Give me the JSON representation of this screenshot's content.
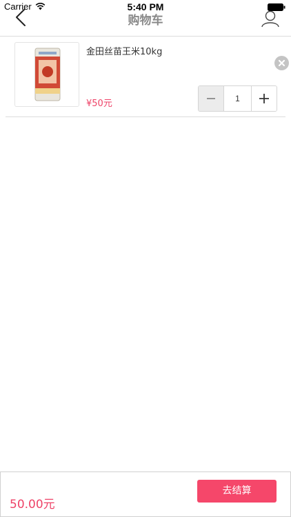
{
  "status_bar": {
    "carrier": "Carrier",
    "time": "5:40 PM"
  },
  "nav": {
    "title": "购物车",
    "back_icon": "chevron-left-icon",
    "user_icon": "user-icon"
  },
  "cart": {
    "items": [
      {
        "name": "金田丝苗王米10kg",
        "price": "¥50元",
        "quantity": "1",
        "minus_label": "−",
        "plus_label": "+"
      }
    ]
  },
  "footer": {
    "total": "50.00元",
    "checkout_label": "去结算"
  },
  "colors": {
    "accent": "#f5476a",
    "price": "#ee4267",
    "title_gray": "#8a8a8a"
  }
}
